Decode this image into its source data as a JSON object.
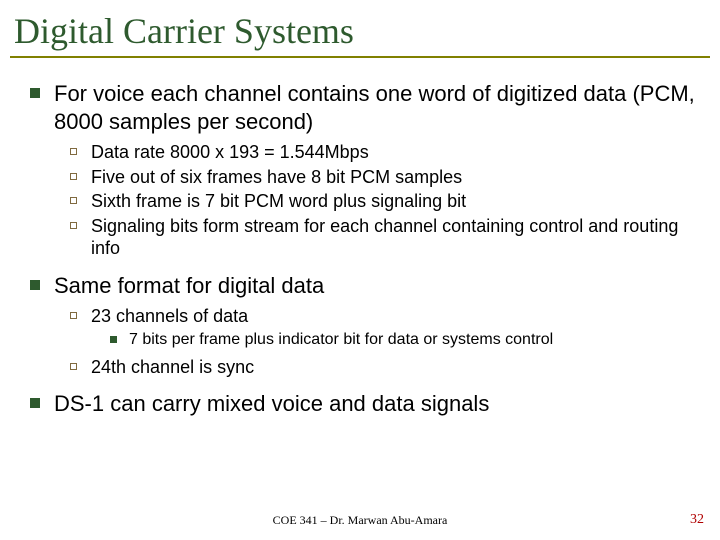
{
  "title": "Digital Carrier Systems",
  "bullets": {
    "p1": "For voice each channel contains one word of digitized data (PCM, 8000 samples per second)",
    "p1_sub": [
      "Data rate 8000 x 193 = 1.544Mbps",
      "Five out of six frames have 8 bit PCM samples",
      "Sixth frame is 7 bit PCM word plus signaling bit",
      "Signaling bits form stream for each channel containing control and routing info"
    ],
    "p2": "Same format for digital data",
    "p2_sub1": "23 channels of data",
    "p2_sub1_sub": "7 bits per frame plus indicator bit for data or systems control",
    "p2_sub2": "24th channel is sync",
    "p3": "DS-1 can carry mixed voice and data signals"
  },
  "footer": {
    "center": "COE 341 – Dr. Marwan Abu-Amara",
    "pagenum": "32"
  }
}
